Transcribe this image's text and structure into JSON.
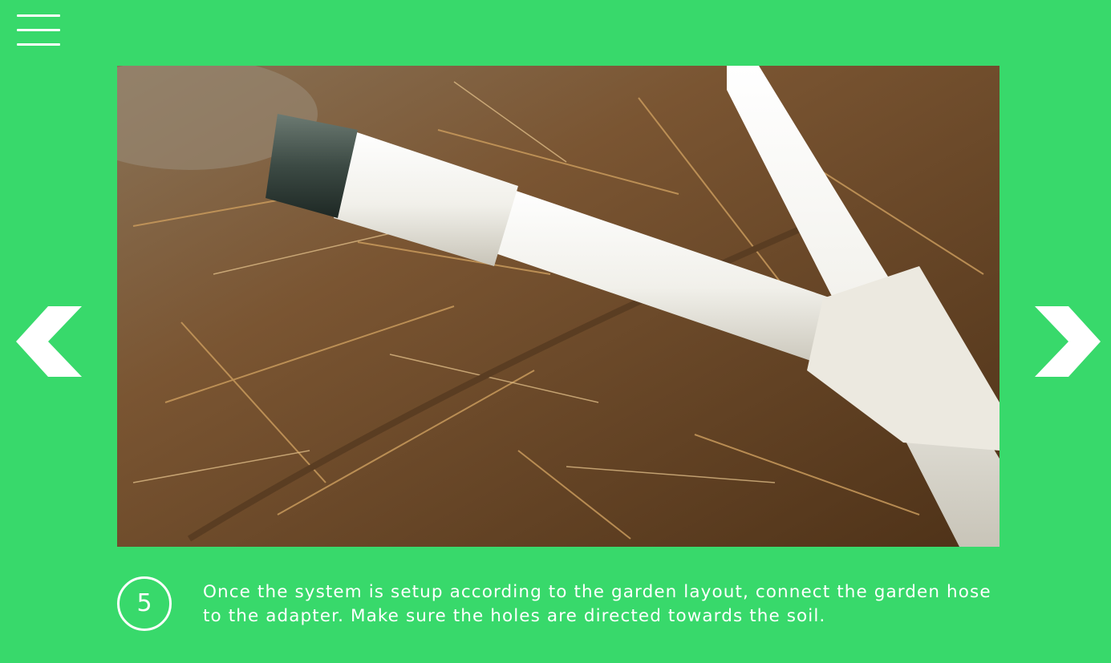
{
  "theme": {
    "background": "#38d96b",
    "foreground": "#ffffff"
  },
  "menu": {
    "icon": "hamburger-menu-icon"
  },
  "navigation": {
    "prev_icon": "chevron-left-icon",
    "next_icon": "chevron-right-icon"
  },
  "slide": {
    "image_subject": "white PVC pipe with metal hose adapter lying on dry straw mulch",
    "step_number": "5",
    "description": "Once the system is setup according to the garden layout, connect the garden hose to the adapter. Make sure the holes are directed towards the soil."
  }
}
